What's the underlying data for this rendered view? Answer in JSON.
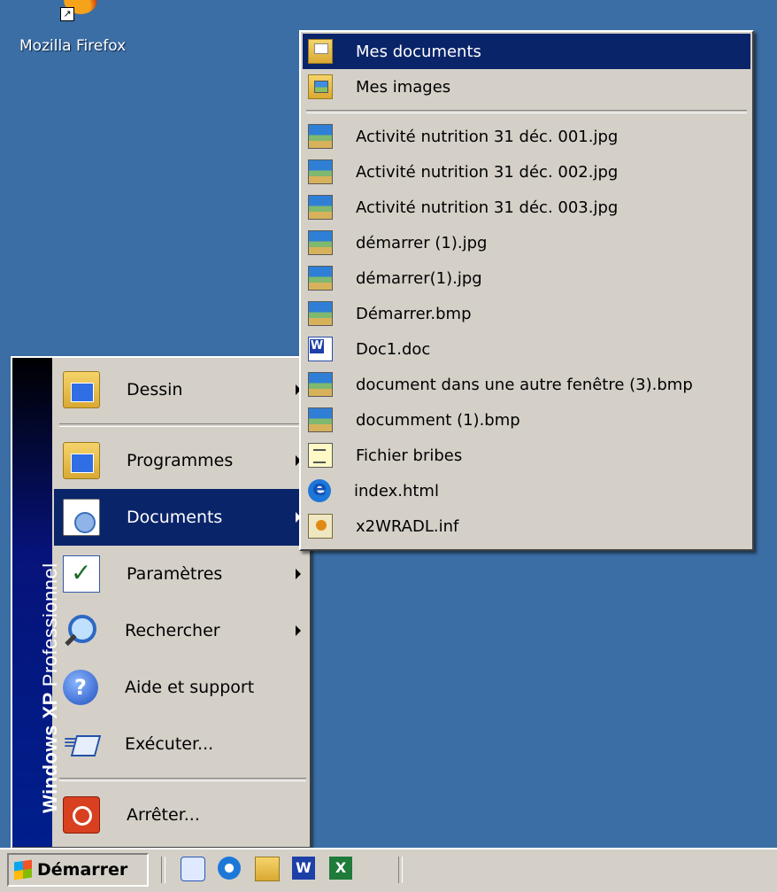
{
  "desktop": {
    "icon_label": "Mozilla Firefox"
  },
  "start_menu": {
    "banner_bold": "Windows XP",
    "banner_light": "Professionnel",
    "items": [
      {
        "label": "Dessin",
        "icon": "drawing-folder-icon",
        "submenu": true
      },
      {
        "label": "Programmes",
        "icon": "programs-folder-icon",
        "submenu": true
      },
      {
        "label": "Documents",
        "icon": "documents-icon",
        "submenu": true,
        "active": true
      },
      {
        "label": "Paramètres",
        "icon": "settings-icon",
        "submenu": true
      },
      {
        "label": "Rechercher",
        "icon": "search-icon",
        "submenu": true
      },
      {
        "label": "Aide et support",
        "icon": "help-icon",
        "submenu": false
      },
      {
        "label": "Exécuter...",
        "icon": "run-icon",
        "submenu": false
      },
      {
        "label": "Arrêter...",
        "icon": "shutdown-icon",
        "submenu": false
      }
    ]
  },
  "documents_submenu": {
    "top_items": [
      {
        "label": "Mes documents",
        "icon": "my-documents-icon",
        "active": true
      },
      {
        "label": "Mes images",
        "icon": "my-pictures-icon"
      }
    ],
    "recent_items": [
      {
        "label": "Activité nutrition 31 déc. 001.jpg",
        "icon": "image-file-icon"
      },
      {
        "label": "Activité nutrition 31 déc. 002.jpg",
        "icon": "image-file-icon"
      },
      {
        "label": "Activité nutrition 31 déc. 003.jpg",
        "icon": "image-file-icon"
      },
      {
        "label": "démarrer (1).jpg",
        "icon": "image-file-icon"
      },
      {
        "label": "démarrer(1).jpg",
        "icon": "image-file-icon"
      },
      {
        "label": "Démarrer.bmp",
        "icon": "image-file-icon"
      },
      {
        "label": "Doc1.doc",
        "icon": "word-document-icon"
      },
      {
        "label": "document dans une autre fenêtre (3).bmp",
        "icon": "image-file-icon"
      },
      {
        "label": "documment (1).bmp",
        "icon": "image-file-icon"
      },
      {
        "label": "Fichier bribes",
        "icon": "scrap-file-icon"
      },
      {
        "label": "index.html",
        "icon": "internet-explorer-icon"
      },
      {
        "label": "x2WRADL.inf",
        "icon": "setup-info-icon"
      }
    ]
  },
  "taskbar": {
    "start_label": "Démarrer",
    "quick_launch": [
      "outlook-express-icon",
      "internet-explorer-icon",
      "explorer-folder-icon",
      "word-icon",
      "excel-icon"
    ],
    "word_glyph": "W",
    "excel_glyph": "X"
  }
}
